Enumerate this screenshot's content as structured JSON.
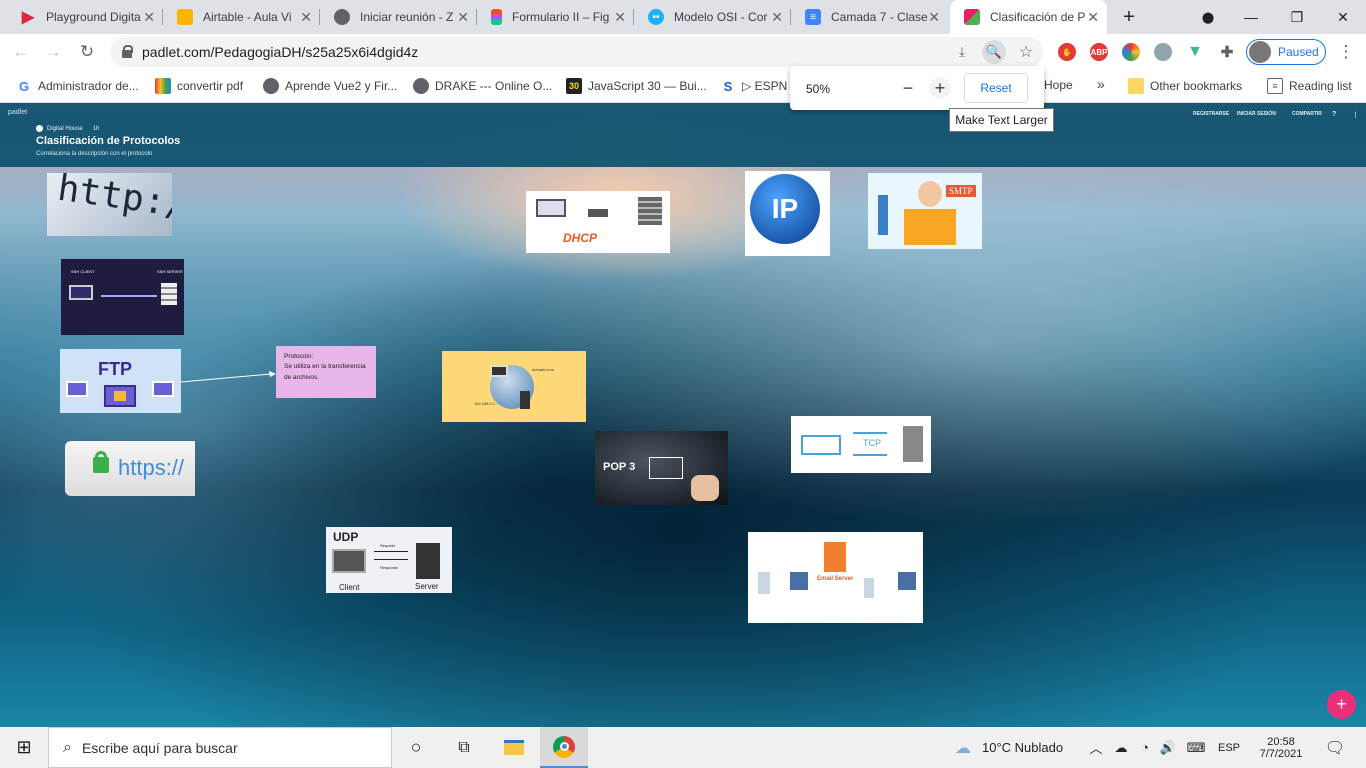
{
  "tabs": [
    {
      "title": "Playground Digita",
      "icon_color": "#e0263a"
    },
    {
      "title": "Airtable - Aula Vi",
      "icon_color": "#fcb400"
    },
    {
      "title": "Iniciar reunión - Z",
      "icon_color": "#5f6368"
    },
    {
      "title": "Formulario II – Fig",
      "icon_color": "#f24e1e"
    },
    {
      "title": "Modelo OSI - Cor",
      "icon_color": "#1cb0f6"
    },
    {
      "title": "Camada 7 - Clase",
      "icon_color": "#4285f4"
    },
    {
      "title": "Clasificación de P",
      "icon_color": "#c2185b"
    }
  ],
  "address": {
    "url": "padlet.com/PedagogiaDH/s25a25x6i4dgid4z"
  },
  "profile": {
    "status": "Paused"
  },
  "bookmarks": [
    {
      "label": "Administrador de...",
      "icon": "google-icon"
    },
    {
      "label": "convertir pdf",
      "icon": "pdf-icon"
    },
    {
      "label": "Aprende Vue2 y Fir...",
      "icon": "globe-icon"
    },
    {
      "label": "DRAKE --- Online O...",
      "icon": "globe-icon"
    },
    {
      "label": "JavaScript 30 — Bui...",
      "icon": "js30-icon"
    },
    {
      "label": "▷ ESPN",
      "icon": "espn-icon"
    },
    {
      "label": "Hope",
      "icon": "none"
    },
    {
      "label": "»",
      "icon": "none"
    },
    {
      "label": "Other bookmarks",
      "icon": "folder-icon"
    },
    {
      "label": "Reading list",
      "icon": "reading-list-icon"
    }
  ],
  "zoom": {
    "level": "50%",
    "reset_label": "Reset",
    "tooltip": "Make Text Larger"
  },
  "padlet": {
    "brand": "padlet",
    "author": "Digital House",
    "time": "1h",
    "title": "Clasificación de Protocolos",
    "subtitle": "Correlaciona la descripción con el protocolo",
    "header_links": [
      "REGISTRARSE",
      "INICIAR SESIÓN",
      "COMPARTIR"
    ]
  },
  "cards": {
    "http": "http://ww",
    "ssh_client": "SSH CLIENT",
    "ssh_server": "SSH SERVER",
    "ftp": "FTP",
    "https": "https://",
    "udp": "UDP",
    "udp_client": "Client",
    "udp_server": "Server",
    "udp_request": "Request",
    "udp_response": "Response",
    "dhcp": "DHCP",
    "ip": "IP",
    "smtp": "SMTP",
    "dns_domain": "domain.com",
    "dns_ip": "192.168.0.1",
    "pop3": "POP 3",
    "tcp": "TCP",
    "email_server": "Email Server"
  },
  "note": {
    "title": "Protocolo:",
    "body": "Se utiliza en la transferencia de archivos."
  },
  "taskbar": {
    "search_placeholder": "Escribe aquí para buscar",
    "weather": "10°C  Nublado",
    "lang": "ESP",
    "time": "20:58",
    "date": "7/7/2021"
  }
}
